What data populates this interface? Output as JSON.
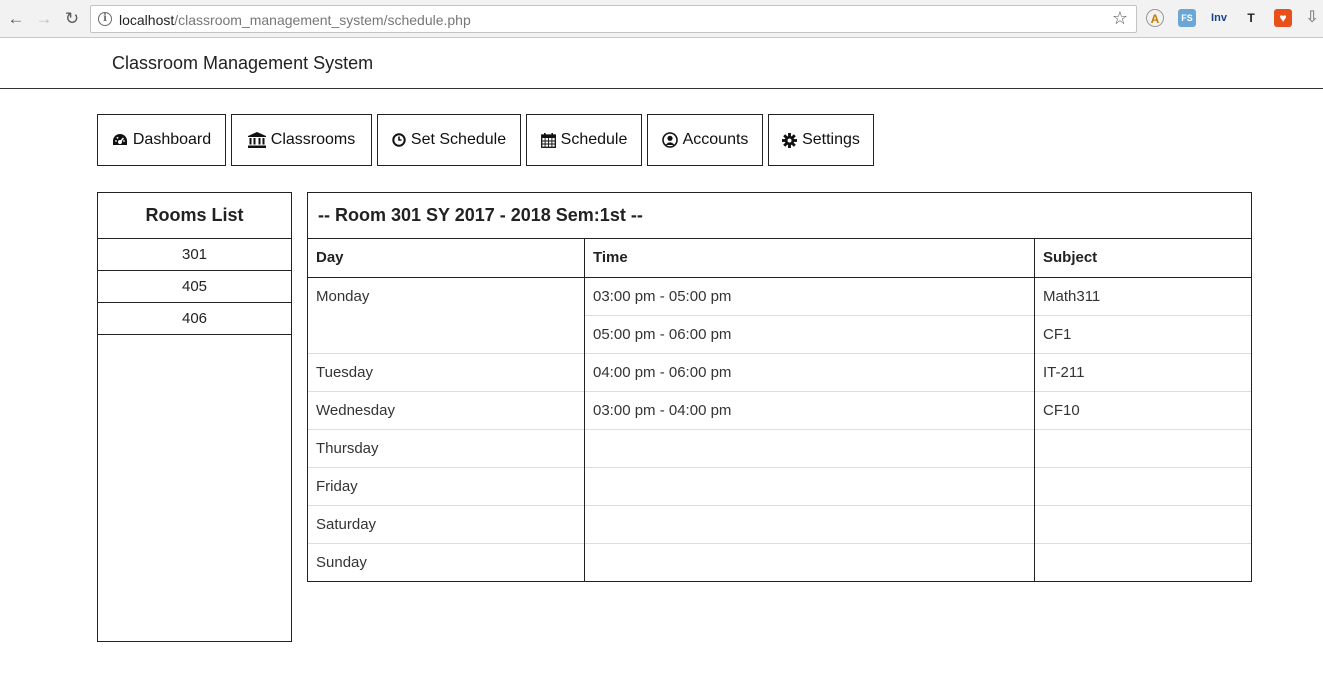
{
  "browser": {
    "url_host": "localhost",
    "url_path": "/classroom_management_system/schedule.php"
  },
  "app": {
    "title": "Classroom Management System"
  },
  "menu": [
    {
      "label": "Dashboard",
      "icon": "dashboard-icon"
    },
    {
      "label": "Classrooms",
      "icon": "bank-icon"
    },
    {
      "label": "Set Schedule",
      "icon": "clock-icon"
    },
    {
      "label": "Schedule",
      "icon": "calendar-icon"
    },
    {
      "label": "Accounts",
      "icon": "user-circle-icon"
    },
    {
      "label": "Settings",
      "icon": "gear-icon"
    }
  ],
  "rooms": {
    "title": "Rooms List",
    "items": [
      "301",
      "405",
      "406"
    ]
  },
  "schedule": {
    "title": "-- Room 301 SY 2017 - 2018 Sem:1st --",
    "headers": {
      "day": "Day",
      "time": "Time",
      "subject": "Subject"
    },
    "days": [
      "Monday",
      "Tuesday",
      "Wednesday",
      "Thursday",
      "Friday",
      "Saturday",
      "Sunday"
    ],
    "times": [
      "03:00 pm - 05:00 pm",
      "05:00 pm - 06:00 pm",
      "04:00 pm - 06:00 pm",
      "03:00 pm - 04:00 pm",
      "",
      "",
      "",
      ""
    ],
    "subjects": [
      "Math311",
      "CF1",
      "IT-211",
      "CF10",
      "",
      "",
      "",
      ""
    ]
  }
}
